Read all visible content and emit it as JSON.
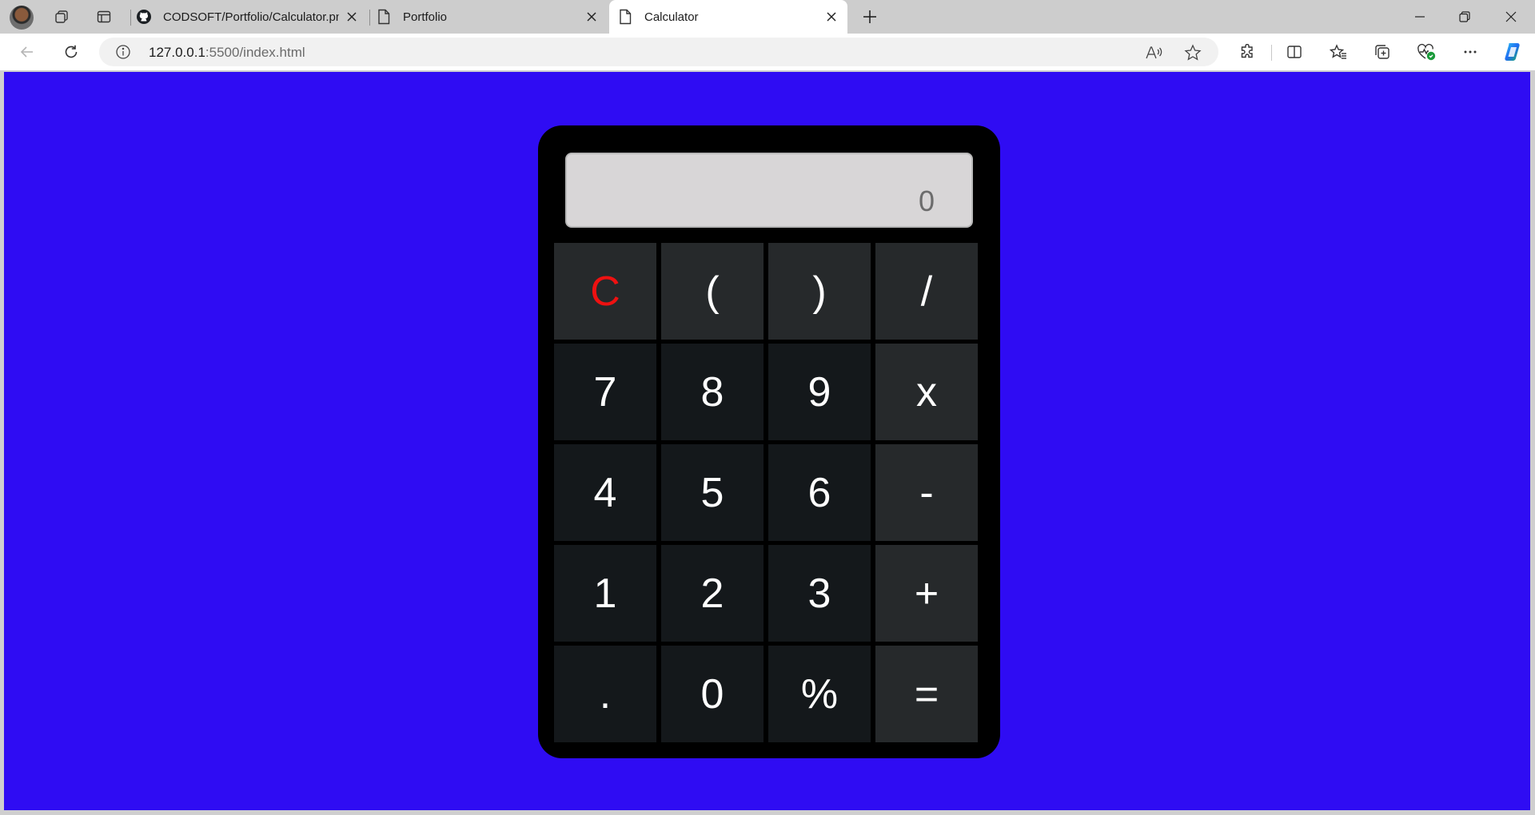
{
  "browser": {
    "tabs": [
      {
        "title": "CODSOFT/Portfolio/Calculator.png",
        "icon": "github-icon",
        "active": false
      },
      {
        "title": "Portfolio",
        "icon": "page-icon",
        "active": false
      },
      {
        "title": "Calculator",
        "icon": "page-icon",
        "active": true
      }
    ],
    "url": {
      "host": "127.0.0.1",
      "rest": ":5500/index.html"
    }
  },
  "calculator": {
    "display_value": "0",
    "keys": [
      {
        "label": "C",
        "kind": "clear"
      },
      {
        "label": "(",
        "kind": "op"
      },
      {
        "label": ")",
        "kind": "op"
      },
      {
        "label": "/",
        "kind": "op"
      },
      {
        "label": "7",
        "kind": "digit"
      },
      {
        "label": "8",
        "kind": "digit"
      },
      {
        "label": "9",
        "kind": "digit"
      },
      {
        "label": "x",
        "kind": "op"
      },
      {
        "label": "4",
        "kind": "digit"
      },
      {
        "label": "5",
        "kind": "digit"
      },
      {
        "label": "6",
        "kind": "digit"
      },
      {
        "label": "-",
        "kind": "op"
      },
      {
        "label": "1",
        "kind": "digit"
      },
      {
        "label": "2",
        "kind": "digit"
      },
      {
        "label": "3",
        "kind": "digit"
      },
      {
        "label": "+",
        "kind": "op"
      },
      {
        "label": ".",
        "kind": "digit"
      },
      {
        "label": "0",
        "kind": "digit"
      },
      {
        "label": "%",
        "kind": "digit"
      },
      {
        "label": "=",
        "kind": "op"
      }
    ]
  },
  "colors": {
    "page_background": "#2f0cf3",
    "calculator_body": "#000000",
    "display_background": "#d8d6d7",
    "digit_key": "#14181b",
    "operator_key": "#26292b",
    "clear_label": "#ee1111"
  }
}
